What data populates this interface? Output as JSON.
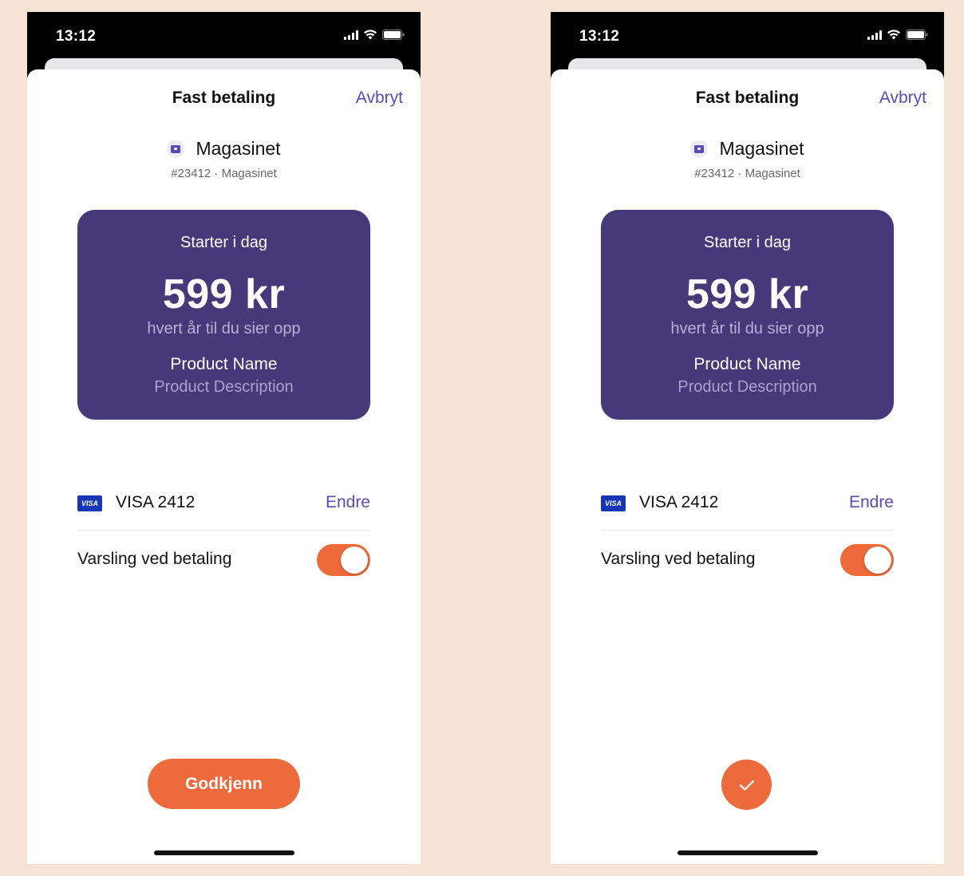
{
  "screens": [
    {
      "status": {
        "time": "13:12"
      },
      "header": {
        "title": "Fast betaling",
        "cancel_label": "Avbryt"
      },
      "merchant": {
        "name": "Magasinet",
        "subtitle": "#23412 · Magasinet",
        "icon": "merchant-icon"
      },
      "price_card": {
        "label": "Starter i dag",
        "amount": "599 kr",
        "interval": "hvert år til du sier opp",
        "product_name": "Product Name",
        "product_description": "Product Description"
      },
      "payment_method": {
        "brand_icon": "VISA",
        "label": "VISA 2412",
        "change_label": "Endre"
      },
      "notification": {
        "label": "Varsling ved betaling",
        "enabled": true
      },
      "action": {
        "type": "button",
        "label": "Godkjenn"
      }
    },
    {
      "status": {
        "time": "13:12"
      },
      "header": {
        "title": "Fast betaling",
        "cancel_label": "Avbryt"
      },
      "merchant": {
        "name": "Magasinet",
        "subtitle": "#23412 · Magasinet",
        "icon": "merchant-icon"
      },
      "price_card": {
        "label": "Starter i dag",
        "amount": "599 kr",
        "interval": "hvert år til du sier opp",
        "product_name": "Product Name",
        "product_description": "Product Description"
      },
      "payment_method": {
        "brand_icon": "VISA",
        "label": "VISA 2412",
        "change_label": "Endre"
      },
      "notification": {
        "label": "Varsling ved betaling",
        "enabled": true
      },
      "action": {
        "type": "checkmark",
        "icon": "checkmark-icon"
      }
    }
  ],
  "colors": {
    "background": "#f6e3d6",
    "accent_purple": "#5b4bb5",
    "card_purple": "#473879",
    "primary_orange": "#ec6a3b",
    "visa_blue": "#1a35b3"
  }
}
